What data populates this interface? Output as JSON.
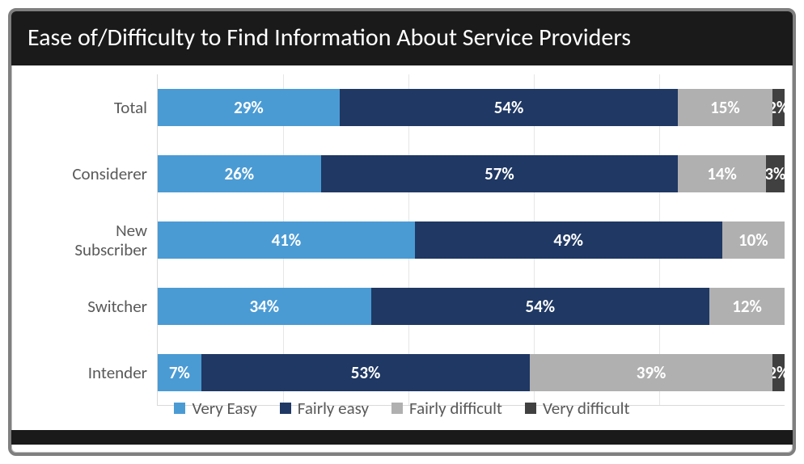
{
  "chart_data": {
    "type": "bar",
    "orientation": "horizontal",
    "stacked": true,
    "title": "Ease of/Difficulty to Find Information About Service Providers",
    "categories": [
      "Total",
      "Considerer",
      "New Subscriber",
      "Switcher",
      "Intender"
    ],
    "series": [
      {
        "name": "Very Easy",
        "color": "#4a9bd4",
        "values": [
          29,
          26,
          41,
          34,
          7
        ]
      },
      {
        "name": "Fairly easy",
        "color": "#1f3864",
        "values": [
          54,
          57,
          49,
          54,
          53
        ]
      },
      {
        "name": "Fairly difficult",
        "color": "#b0b0b0",
        "values": [
          15,
          14,
          10,
          12,
          39
        ]
      },
      {
        "name": "Very difficult",
        "color": "#404040",
        "values": [
          2,
          3,
          0,
          0,
          2
        ]
      }
    ],
    "xlim": [
      0,
      100
    ],
    "value_suffix": "%"
  }
}
